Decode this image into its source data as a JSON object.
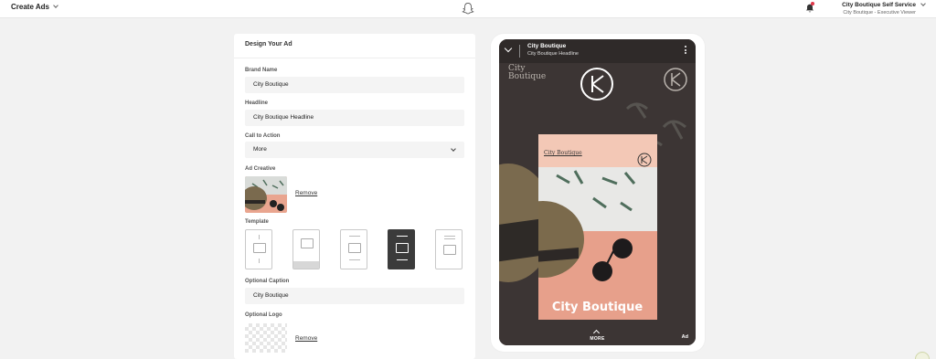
{
  "topbar": {
    "menu_label": "Create Ads",
    "account_name": "City Boutique Self Service",
    "account_role": "City Boutique - Executive Viewer"
  },
  "form": {
    "title": "Design Your Ad",
    "brand_name": {
      "label": "Brand Name",
      "value": "City Boutique"
    },
    "headline": {
      "label": "Headline",
      "value": "City Boutique Headline"
    },
    "call_to_action": {
      "label": "Call to Action",
      "value": "More"
    },
    "ad_creative": {
      "label": "Ad Creative",
      "remove": "Remove"
    },
    "template": {
      "label": "Template",
      "selected_index": 3
    },
    "optional_caption": {
      "label": "Optional Caption",
      "value": "City Boutique"
    },
    "optional_logo": {
      "label": "Optional Logo",
      "remove": "Remove"
    }
  },
  "preview": {
    "title": "City Boutique",
    "subtitle": "City Boutique Headline",
    "logo_text": "City Boutique",
    "card_logo_text": "City Boutique",
    "caption": "City Boutique",
    "cta": "MORE",
    "ad_badge": "Ad"
  },
  "icons": [
    "chevron-down-icon",
    "snapchat-ghost-icon",
    "bell-icon",
    "image-icon",
    "more-vert-icon",
    "chevron-up-icon"
  ],
  "colors": {
    "background": "#f2f2f2",
    "phone": "#3a3433",
    "card": "#f3c8b6",
    "accent_red": "#e0374a"
  }
}
